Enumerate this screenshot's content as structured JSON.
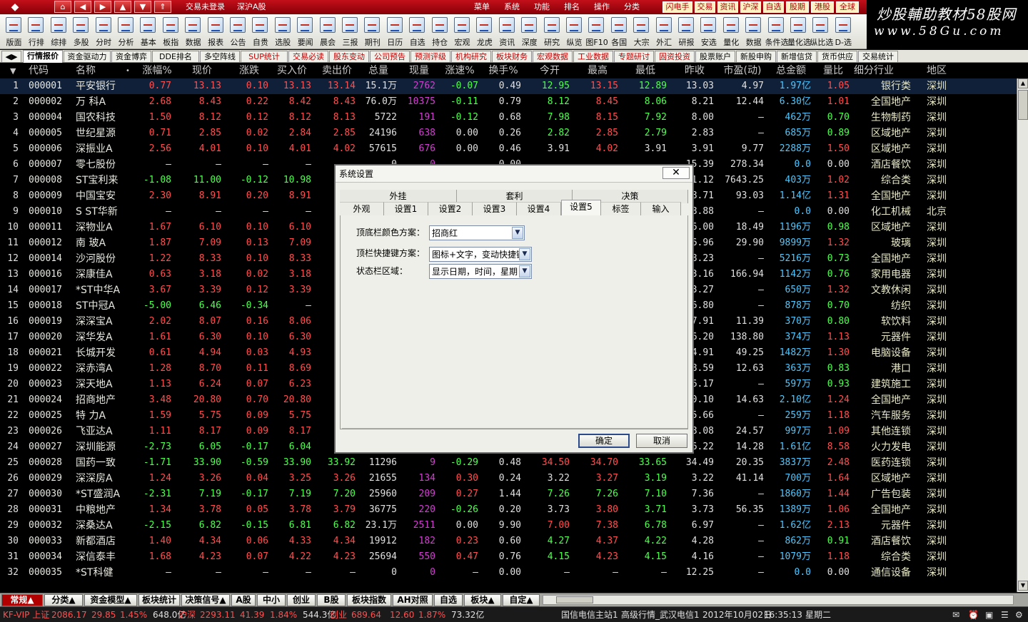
{
  "titlebar": {
    "login": "交易未登录",
    "market": "深沪A股",
    "menus": [
      "菜单",
      "系统",
      "功能",
      "排名",
      "操作",
      "分类"
    ],
    "quick_buttons": [
      "闪电手",
      "交易",
      "资讯",
      "沪深",
      "自选",
      "股期",
      "港股",
      "全球"
    ]
  },
  "watermark": {
    "line1": "炒股輔助教材58股网",
    "line2": "www.58Gu.com"
  },
  "toolbar": {
    "tools": [
      "版面",
      "行排",
      "综排",
      "多股",
      "分时",
      "分析",
      "基本",
      "板指",
      "数据",
      "报表",
      "公告",
      "自贵",
      "选股",
      "要闻",
      "晨会",
      "三报",
      "期刊",
      "日历",
      "自选",
      "持仓",
      "宏观",
      "龙虎",
      "资讯",
      "深度",
      "研究",
      "纵览",
      "图F10",
      "各国",
      "大宗",
      "外汇",
      "研报",
      "安选",
      "量化",
      "数据",
      "条件选",
      "量化选",
      "纵比选",
      "D-选"
    ]
  },
  "page_tabs": [
    "行情报价",
    "资金驱动力",
    "资金博弈",
    "DDE排名",
    "多空阵线",
    "SUP统计",
    "交易必读",
    "股东变动",
    "公司预告",
    "预测评级",
    "机构研究",
    "板块财务",
    "宏观数据",
    "工业数据",
    "专题研讨",
    "固资投资",
    "股票账户",
    "新股申购",
    "新增信贷",
    "货币供应",
    "交易统计"
  ],
  "table": {
    "columns": [
      "代码",
      "名称",
      "•",
      "涨幅%",
      "现价",
      "涨跌",
      "买入价",
      "卖出价",
      "总量",
      "现量",
      "涨速%",
      "换手%",
      "今开",
      "最高",
      "最低",
      "昨收",
      "市盈(动)",
      "总金额",
      "量比",
      "细分行业",
      "地区"
    ],
    "rows": [
      [
        "1",
        "000001",
        "平安银行",
        "0.77",
        "13.13",
        "0.10",
        "13.13",
        "13.14",
        "15.1万",
        "2762",
        "-0.07",
        "0.49",
        "12.95",
        "13.15",
        "12.89",
        "13.03",
        "4.97",
        "1.97亿",
        "1.05",
        "银行类",
        "深圳"
      ],
      [
        "2",
        "000002",
        "万 科A",
        "2.68",
        "8.43",
        "0.22",
        "8.42",
        "8.43",
        "76.0万",
        "10375",
        "-0.11",
        "0.79",
        "8.12",
        "8.45",
        "8.06",
        "8.21",
        "12.44",
        "6.30亿",
        "1.01",
        "全国地产",
        "深圳"
      ],
      [
        "3",
        "000004",
        "国农科技",
        "1.50",
        "8.12",
        "0.12",
        "8.12",
        "8.13",
        "5722",
        "191",
        "-0.12",
        "0.68",
        "7.98",
        "8.15",
        "7.92",
        "8.00",
        "—",
        "462万",
        "0.70",
        "生物制药",
        "深圳"
      ],
      [
        "4",
        "000005",
        "世纪星源",
        "0.71",
        "2.85",
        "0.02",
        "2.84",
        "2.85",
        "24196",
        "638",
        "0.00",
        "0.26",
        "2.82",
        "2.85",
        "2.79",
        "2.83",
        "—",
        "685万",
        "0.89",
        "区域地产",
        "深圳"
      ],
      [
        "5",
        "000006",
        "深振业A",
        "2.56",
        "4.01",
        "0.10",
        "4.01",
        "4.02",
        "57615",
        "676",
        "0.00",
        "0.46",
        "3.91",
        "4.02",
        "3.91",
        "3.91",
        "9.77",
        "2288万",
        "1.50",
        "区域地产",
        "深圳"
      ],
      [
        "6",
        "000007",
        "零七股份",
        "—",
        "—",
        "—",
        "—",
        "—",
        "0",
        "0",
        "—",
        "0.00",
        "—",
        "—",
        "—",
        "15.39",
        "278.34",
        "0.0",
        "0.00",
        "酒店餐饮",
        "深圳"
      ],
      [
        "7",
        "000008",
        "ST宝利来",
        "-1.08",
        "11.00",
        "-0.12",
        "10.98",
        "",
        "",
        "",
        "",
        "",
        "",
        "",
        "",
        "11.12",
        "7643.25",
        "403万",
        "1.02",
        "综合类",
        "深圳"
      ],
      [
        "8",
        "000009",
        "中国宝安",
        "2.30",
        "8.91",
        "0.20",
        "8.91",
        "",
        "",
        "",
        "",
        "",
        "",
        "",
        "",
        "8.71",
        "93.03",
        "1.14亿",
        "1.31",
        "全国地产",
        "深圳"
      ],
      [
        "9",
        "000010",
        "S ST华新",
        "—",
        "—",
        "—",
        "—",
        "",
        "",
        "",
        "",
        "",
        "",
        "",
        "",
        "8.88",
        "—",
        "0.0",
        "0.00",
        "化工机械",
        "北京"
      ],
      [
        "10",
        "000011",
        "深物业A",
        "1.67",
        "6.10",
        "0.10",
        "6.10",
        "",
        "",
        "",
        "",
        "",
        "",
        "",
        "",
        "6.00",
        "18.49",
        "1196万",
        "0.98",
        "区域地产",
        "深圳"
      ],
      [
        "11",
        "000012",
        "南 玻A",
        "1.87",
        "7.09",
        "0.13",
        "7.09",
        "",
        "",
        "",
        "",
        "",
        "",
        "",
        "",
        "6.96",
        "29.90",
        "9899万",
        "1.32",
        "玻璃",
        "深圳"
      ],
      [
        "12",
        "000014",
        "沙河股份",
        "1.22",
        "8.33",
        "0.10",
        "8.33",
        "",
        "",
        "",
        "",
        "",
        "",
        "",
        "",
        "8.23",
        "—",
        "5216万",
        "0.73",
        "全国地产",
        "深圳"
      ],
      [
        "13",
        "000016",
        "深康佳A",
        "0.63",
        "3.18",
        "0.02",
        "3.18",
        "",
        "",
        "",
        "",
        "",
        "",
        "",
        "",
        "3.16",
        "166.94",
        "1142万",
        "0.76",
        "家用电器",
        "深圳"
      ],
      [
        "14",
        "000017",
        "*ST中华A",
        "3.67",
        "3.39",
        "0.12",
        "3.39",
        "",
        "",
        "",
        "",
        "",
        "",
        "",
        "",
        "3.27",
        "—",
        "650万",
        "1.32",
        "文教休闲",
        "深圳"
      ],
      [
        "15",
        "000018",
        "ST中冠A",
        "-5.00",
        "6.46",
        "-0.34",
        "—",
        "",
        "",
        "",
        "",
        "",
        "",
        "",
        "",
        "6.80",
        "—",
        "878万",
        "0.70",
        "纺织",
        "深圳"
      ],
      [
        "16",
        "000019",
        "深深宝A",
        "2.02",
        "8.07",
        "0.16",
        "8.06",
        "",
        "",
        "",
        "",
        "",
        "",
        "",
        "",
        "7.91",
        "11.39",
        "370万",
        "0.80",
        "软饮料",
        "深圳"
      ],
      [
        "17",
        "000020",
        "深华发A",
        "1.61",
        "6.30",
        "0.10",
        "6.30",
        "",
        "",
        "",
        "",
        "",
        "",
        "",
        "",
        "6.20",
        "138.80",
        "374万",
        "1.13",
        "元器件",
        "深圳"
      ],
      [
        "18",
        "000021",
        "长城开发",
        "0.61",
        "4.94",
        "0.03",
        "4.93",
        "",
        "",
        "",
        "",
        "",
        "",
        "",
        "",
        "4.91",
        "49.25",
        "1482万",
        "1.30",
        "电脑设备",
        "深圳"
      ],
      [
        "19",
        "000022",
        "深赤湾A",
        "1.28",
        "8.70",
        "0.11",
        "8.69",
        "",
        "",
        "",
        "",
        "",
        "",
        "",
        "",
        "8.59",
        "12.63",
        "363万",
        "0.83",
        "港口",
        "深圳"
      ],
      [
        "20",
        "000023",
        "深天地A",
        "1.13",
        "6.24",
        "0.07",
        "6.23",
        "",
        "",
        "",
        "",
        "",
        "",
        "",
        "",
        "6.17",
        "—",
        "597万",
        "0.93",
        "建筑施工",
        "深圳"
      ],
      [
        "21",
        "000024",
        "招商地产",
        "3.48",
        "20.80",
        "0.70",
        "20.80",
        "",
        "",
        "",
        "",
        "",
        "",
        "",
        "",
        "20.10",
        "14.63",
        "2.10亿",
        "1.24",
        "全国地产",
        "深圳"
      ],
      [
        "22",
        "000025",
        "特 力A",
        "1.59",
        "5.75",
        "0.09",
        "5.75",
        "",
        "",
        "",
        "",
        "",
        "",
        "",
        "",
        "5.66",
        "—",
        "259万",
        "1.18",
        "汽车服务",
        "深圳"
      ],
      [
        "23",
        "000026",
        "飞亚达A",
        "1.11",
        "8.17",
        "0.09",
        "8.17",
        "",
        "",
        "",
        "",
        "",
        "",
        "",
        "",
        "8.08",
        "24.57",
        "997万",
        "1.09",
        "其他连锁",
        "深圳"
      ],
      [
        "24",
        "000027",
        "深圳能源",
        "-2.73",
        "6.05",
        "-0.17",
        "6.04",
        "",
        "",
        "",
        "",
        "",
        "",
        "",
        "",
        "6.22",
        "14.28",
        "1.61亿",
        "8.58",
        "火力发电",
        "深圳"
      ],
      [
        "25",
        "000028",
        "国药一致",
        "-1.71",
        "33.90",
        "-0.59",
        "33.90",
        "33.92",
        "11296",
        "9",
        "-0.29",
        "0.48",
        "34.50",
        "34.70",
        "33.65",
        "34.49",
        "20.35",
        "3837万",
        "2.48",
        "医药连锁",
        "深圳"
      ],
      [
        "26",
        "000029",
        "深深房A",
        "1.24",
        "3.26",
        "0.04",
        "3.25",
        "3.26",
        "21655",
        "134",
        "0.30",
        "0.24",
        "3.22",
        "3.27",
        "3.19",
        "3.22",
        "41.14",
        "700万",
        "1.64",
        "区域地产",
        "深圳"
      ],
      [
        "27",
        "000030",
        "*ST盛润A",
        "-2.31",
        "7.19",
        "-0.17",
        "7.19",
        "7.20",
        "25960",
        "209",
        "0.27",
        "1.44",
        "7.26",
        "7.26",
        "7.10",
        "7.36",
        "—",
        "1860万",
        "1.44",
        "广告包装",
        "深圳"
      ],
      [
        "28",
        "000031",
        "中粮地产",
        "1.34",
        "3.78",
        "0.05",
        "3.78",
        "3.79",
        "36775",
        "220",
        "-0.26",
        "0.20",
        "3.73",
        "3.80",
        "3.71",
        "3.73",
        "56.35",
        "1389万",
        "1.06",
        "全国地产",
        "深圳"
      ],
      [
        "29",
        "000032",
        "深桑达A",
        "-2.15",
        "6.82",
        "-0.15",
        "6.81",
        "6.82",
        "23.1万",
        "2511",
        "0.00",
        "9.90",
        "7.00",
        "7.38",
        "6.78",
        "6.97",
        "—",
        "1.62亿",
        "2.13",
        "元器件",
        "深圳"
      ],
      [
        "30",
        "000033",
        "新都酒店",
        "1.40",
        "4.34",
        "0.06",
        "4.33",
        "4.34",
        "19912",
        "182",
        "0.23",
        "0.60",
        "4.27",
        "4.37",
        "4.22",
        "4.28",
        "—",
        "862万",
        "0.91",
        "酒店餐饮",
        "深圳"
      ],
      [
        "31",
        "000034",
        "深信泰丰",
        "1.68",
        "4.23",
        "0.07",
        "4.22",
        "4.23",
        "25694",
        "550",
        "0.47",
        "0.76",
        "4.15",
        "4.23",
        "4.15",
        "4.16",
        "—",
        "1079万",
        "1.18",
        "综合类",
        "深圳"
      ],
      [
        "32",
        "000035",
        "*ST科健",
        "—",
        "—",
        "—",
        "—",
        "—",
        "0",
        "0",
        "—",
        "0.00",
        "—",
        "—",
        "—",
        "12.25",
        "—",
        "0.0",
        "0.00",
        "通信设备",
        "深圳"
      ]
    ]
  },
  "bottom_tabs": [
    "常规▲",
    "分类▲",
    "资金模型▲",
    "板块统计",
    "决策信号▲",
    "A股",
    "中小",
    "创业",
    "B股",
    "板块指数",
    "AH对照",
    "自选",
    "板块▲",
    "自定▲"
  ],
  "status": {
    "sh_label": "KF-VIP 上证",
    "sh_index": "2086.17",
    "sh_change": "29.85",
    "sh_pct": "1.45%",
    "sh_amount": "648.0亿",
    "sz_label": "沪深",
    "sz_index": "2293.11",
    "sz_change": "41.39",
    "sz_pct": "1.84%",
    "sz_amount": "544.3亿",
    "cy_label": "创业",
    "cy_index": "689.64",
    "cy_change": "12.60",
    "cy_pct": "1.87%",
    "cy_amount": "73.32亿",
    "server": "国信电信主站1",
    "info": "高级行情_武汉电信1",
    "date": "2012年10月02日",
    "time": "16:35:13",
    "weekday": "星期二"
  },
  "dialog": {
    "title": "系统设置",
    "close": "✕",
    "tabs_row1": [
      "外挂",
      "套利",
      "决策"
    ],
    "tabs_row2": [
      "外观",
      "设置1",
      "设置2",
      "设置3",
      "设置4",
      "设置5",
      "标签",
      "输入"
    ],
    "active_tab": "设置5",
    "fields": [
      {
        "label": "顶底栏颜色方案：",
        "value": "招商红"
      },
      {
        "label": "顶栏快捷键方案：",
        "value": "图标+文字，变动快捷键"
      },
      {
        "label": "状态栏区域：",
        "value": "显示日期，时间，星期"
      }
    ],
    "ok": "确定",
    "cancel": "取消"
  },
  "colors": {
    "up": "#ff5050",
    "down": "#50ff50",
    "flat": "#e0e0e0",
    "name": "#e8e8e0",
    "code": "#e8e8e0",
    "amount": "#50c8ff",
    "industry": "#e8e8c8",
    "volume_now": "#d040d0",
    "header": "#c8c8c8",
    "accent_red": "#b00000"
  }
}
